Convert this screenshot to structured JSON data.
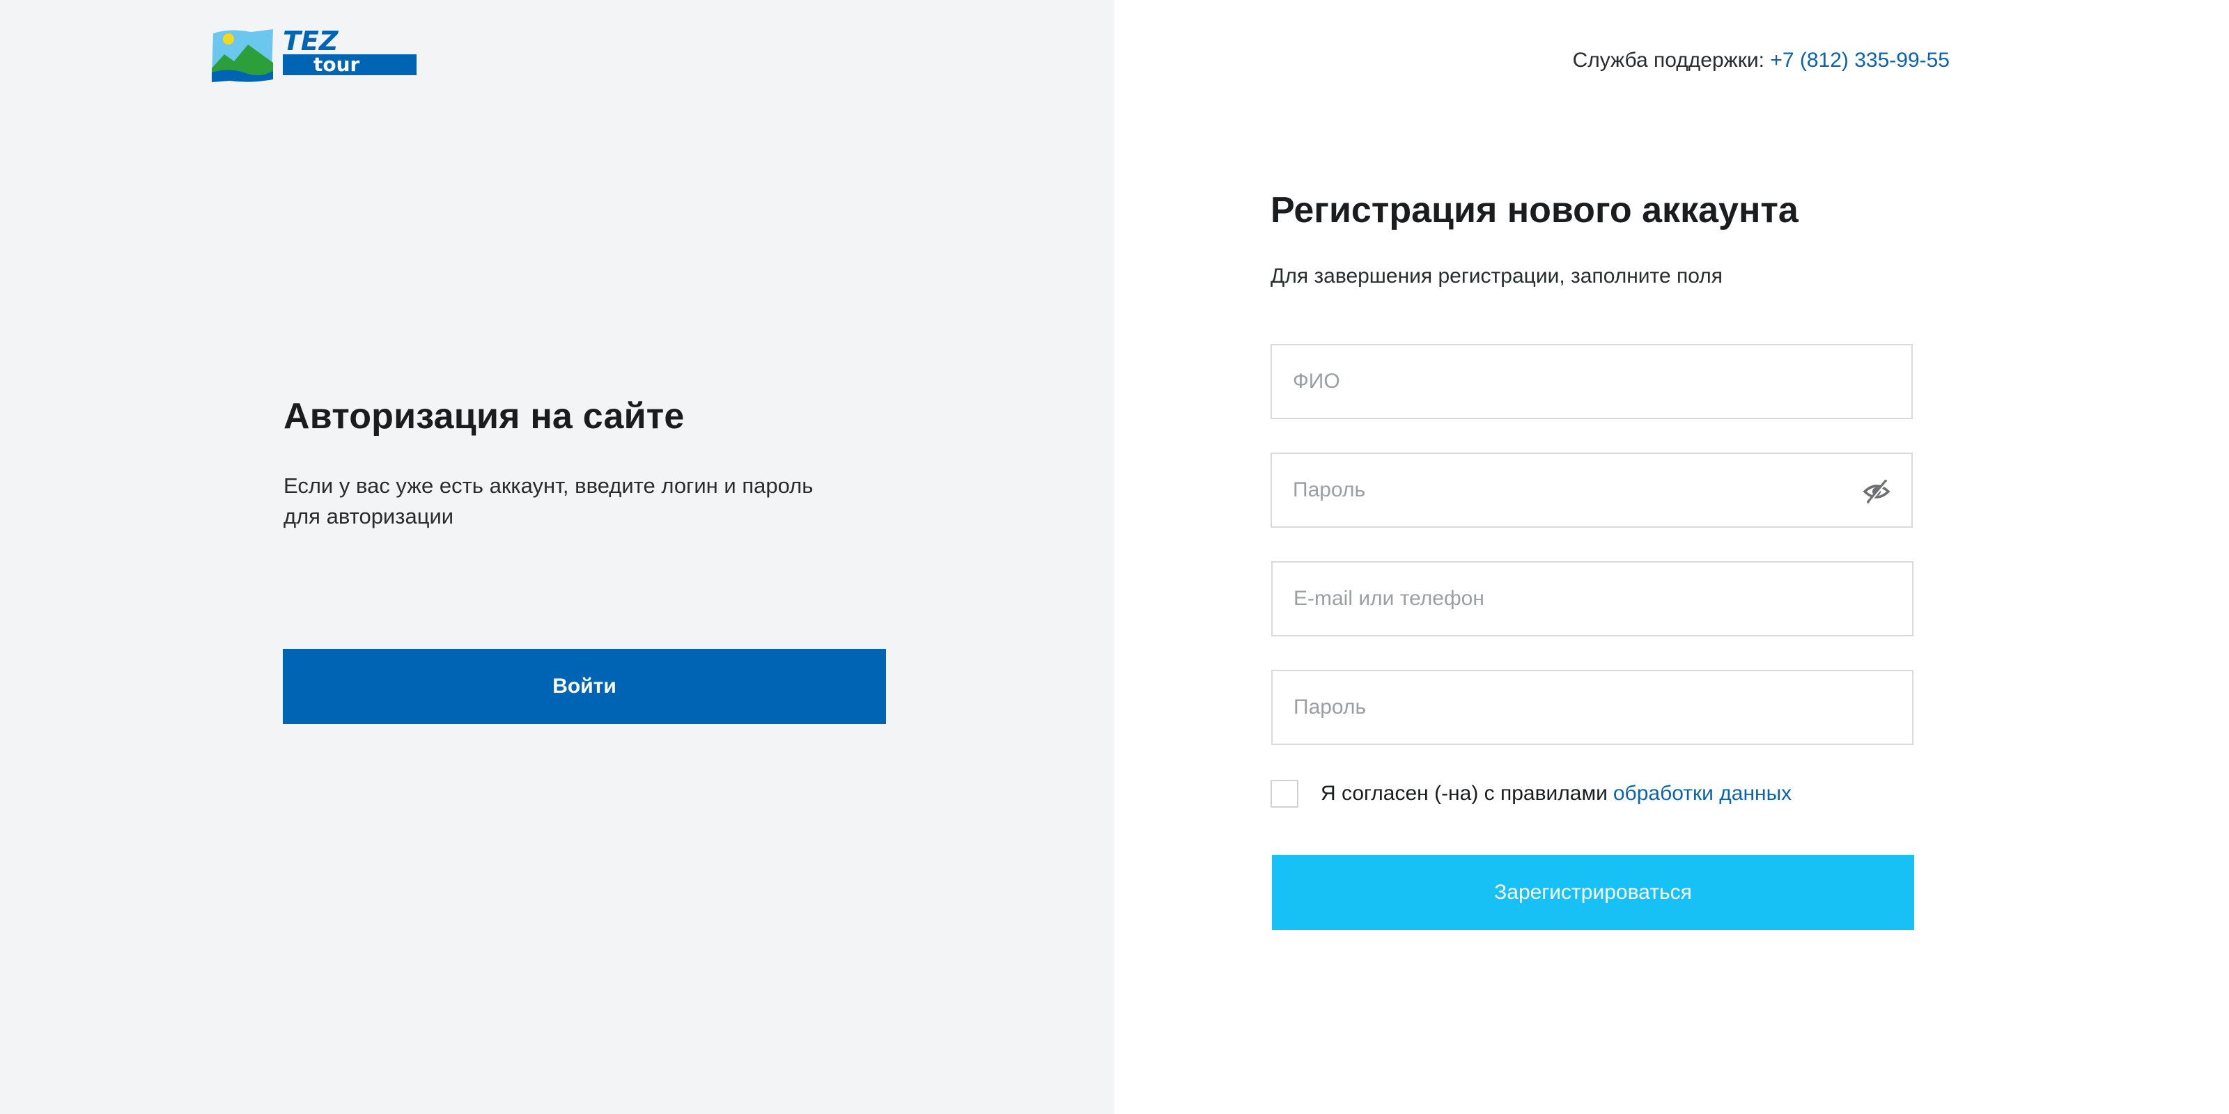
{
  "logo": {
    "text_top": "TEZ",
    "text_bottom": "tour",
    "colors": {
      "brand_blue": "#0064b4",
      "sky": "#6cc7ee",
      "green": "#2d9f3a",
      "sun": "#f5d81c"
    }
  },
  "auth": {
    "title": "Авторизация на сайте",
    "description": "Если у вас уже есть аккаунт, введите логин и пароль для авторизации",
    "login_label": "Войти"
  },
  "support": {
    "label": "Служба поддержки:",
    "phone": "+7 (812) 335-99-55"
  },
  "registration": {
    "title": "Регистрация нового аккаунта",
    "subtitle": "Для завершения регистрации, заполните поля",
    "fields": [
      {
        "placeholder": "ФИО",
        "value": ""
      },
      {
        "placeholder": "Пароль",
        "value": "",
        "icon": "eye-slash-icon"
      },
      {
        "placeholder": "E-mail или телефон",
        "value": ""
      },
      {
        "placeholder": "Пароль",
        "value": ""
      }
    ],
    "consent_text": "Я согласен (-на) с правилами",
    "consent_link": "обработки данных",
    "consent_checked": false,
    "register_label": "Зарегистрироваться"
  },
  "colors": {
    "left_bg": "#f3f4f6",
    "right_bg": "#ffffff",
    "primary": "#0064b4",
    "accent": "#17c1f5",
    "link": "#0b62b0"
  }
}
